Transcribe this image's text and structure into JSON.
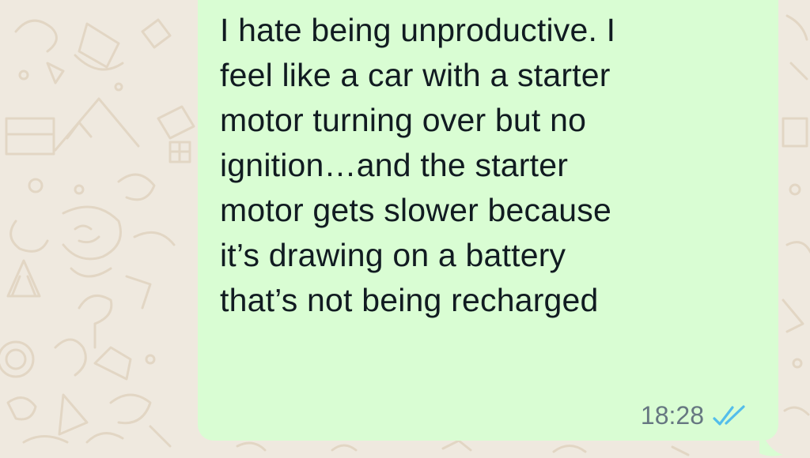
{
  "chat": {
    "message": {
      "text": "I hate being unproductive. I\nfeel like a car with a starter\nmotor turning over but no\nignition…and the starter\nmotor gets slower because\nit’s drawing on a battery\nthat’s not being recharged",
      "time": "18:28",
      "status_icon": "double-check-read-icon"
    },
    "colors": {
      "wallpaper": "#efe9df",
      "wallpaper_doodle": "#e2d6c4",
      "bubble_outgoing": "#d9fdd3",
      "text": "#111b21",
      "meta": "#667781",
      "read_ticks": "#53bdeb"
    }
  }
}
